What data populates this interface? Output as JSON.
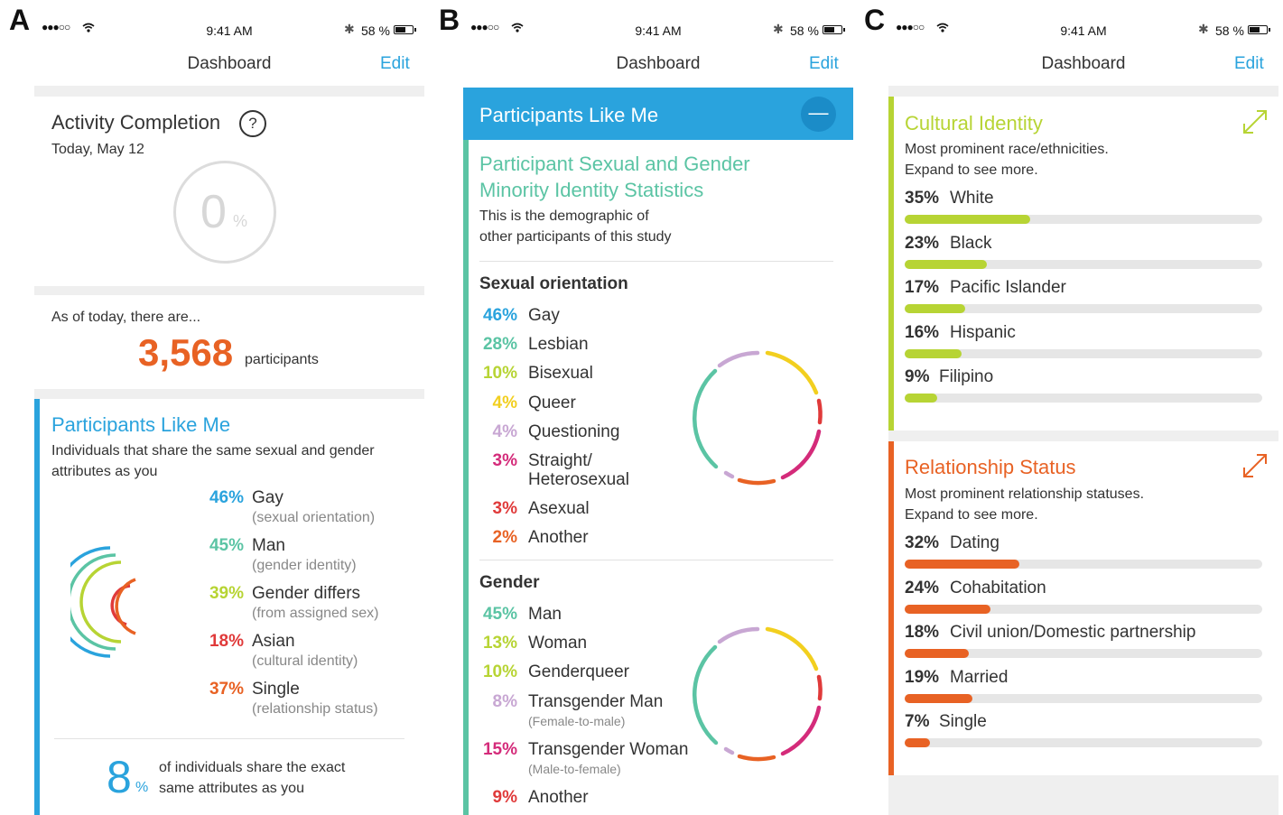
{
  "panel_letters": [
    "A",
    "B",
    "C"
  ],
  "status": {
    "signal": "●●●○○",
    "time": "9:41 AM",
    "bt": "✱",
    "battery": "58 %"
  },
  "nav": {
    "title": "Dashboard",
    "edit": "Edit"
  },
  "colors": {
    "blue": "#2aa3dd",
    "teal": "#5bc4a4",
    "lime": "#b7d434",
    "yellow": "#f2cf1f",
    "lilac": "#c8a7d3",
    "pink": "#d42b7a",
    "red": "#e03a3a",
    "orange": "#e86224"
  },
  "panelA": {
    "activity": {
      "title": "Activity Completion",
      "help": "?",
      "date": "Today, May 12",
      "value": "0",
      "unit": "%"
    },
    "count": {
      "intro": "As of today, there are...",
      "number": "3,568",
      "unit": "participants"
    },
    "plm": {
      "title": "Participants Like Me",
      "desc1": "Individuals that share the same sexual and gender",
      "desc2": "attributes as you",
      "items": [
        {
          "pct": "46%",
          "label": "Gay",
          "sub": "(sexual orientation)",
          "color": "#2aa3dd"
        },
        {
          "pct": "45%",
          "label": "Man",
          "sub": "(gender identity)",
          "color": "#5bc4a4"
        },
        {
          "pct": "39%",
          "label": "Gender differs",
          "sub": "(from assigned sex)",
          "color": "#b7d434"
        },
        {
          "pct": "18%",
          "label": "Asian",
          "sub": "(cultural identity)",
          "color": "#e03a3a"
        },
        {
          "pct": "37%",
          "label": "Single",
          "sub": "(relationship status)",
          "color": "#e86224"
        }
      ],
      "exact": {
        "value": "8",
        "unit": "%",
        "line1": "of individuals share the exact",
        "line2": "same attributes as you"
      }
    }
  },
  "panelB": {
    "header": {
      "title": "Participants Like Me",
      "collapse": "—"
    },
    "heading1": "Participant Sexual and Gender",
    "heading2": "Minority Identity Statistics",
    "desc1": "This is the demographic of",
    "desc2": "other participants of this study",
    "orientation": {
      "title": "Sexual orientation",
      "items": [
        {
          "pct": "46%",
          "label": "Gay",
          "color": "#2aa3dd"
        },
        {
          "pct": "28%",
          "label": "Lesbian",
          "color": "#5bc4a4"
        },
        {
          "pct": "10%",
          "label": "Bisexual",
          "color": "#b7d434"
        },
        {
          "pct": "4%",
          "label": "Queer",
          "color": "#f2cf1f"
        },
        {
          "pct": "4%",
          "label": "Questioning",
          "color": "#c8a7d3"
        },
        {
          "pct": "3%",
          "label": "Straight/",
          "label2": "Heterosexual",
          "color": "#d42b7a"
        },
        {
          "pct": "3%",
          "label": "Asexual",
          "color": "#e03a3a"
        },
        {
          "pct": "2%",
          "label": "Another",
          "color": "#e86224"
        }
      ]
    },
    "gender": {
      "title": "Gender",
      "items": [
        {
          "pct": "45%",
          "label": "Man",
          "color": "#5bc4a4"
        },
        {
          "pct": "13%",
          "label": "Woman",
          "color": "#b7d434"
        },
        {
          "pct": "10%",
          "label": "Genderqueer",
          "color": "#b7d434"
        },
        {
          "pct": "8%",
          "label": "Transgender Man",
          "sub": "(Female-to-male)",
          "color": "#c8a7d3"
        },
        {
          "pct": "15%",
          "label": "Transgender Woman",
          "sub": "(Male-to-female)",
          "color": "#d42b7a"
        },
        {
          "pct": "9%",
          "label": "Another",
          "color": "#e03a3a"
        }
      ]
    }
  },
  "panelC": {
    "cultural": {
      "title": "Cultural Identity",
      "desc1": "Most prominent race/ethnicities.",
      "desc2": "Expand to see more.",
      "color": "#b7d434",
      "items": [
        {
          "pct": "35%",
          "label": "White",
          "value": 35
        },
        {
          "pct": "23%",
          "label": "Black",
          "value": 23
        },
        {
          "pct": "17%",
          "label": "Pacific Islander",
          "value": 17
        },
        {
          "pct": "16%",
          "label": "Hispanic",
          "value": 16
        },
        {
          "pct": "9%",
          "label": "Filipino",
          "value": 9
        }
      ]
    },
    "relationship": {
      "title": "Relationship Status",
      "desc1": "Most prominent relationship statuses.",
      "desc2": "Expand to see more.",
      "color": "#e86224",
      "items": [
        {
          "pct": "32%",
          "label": "Dating",
          "value": 32
        },
        {
          "pct": "24%",
          "label": "Cohabitation",
          "value": 24
        },
        {
          "pct": "18%",
          "label": "Civil union/Domestic partnership",
          "value": 18
        },
        {
          "pct": "19%",
          "label": "Married",
          "value": 19
        },
        {
          "pct": "7%",
          "label": "Single",
          "value": 7
        }
      ]
    }
  }
}
